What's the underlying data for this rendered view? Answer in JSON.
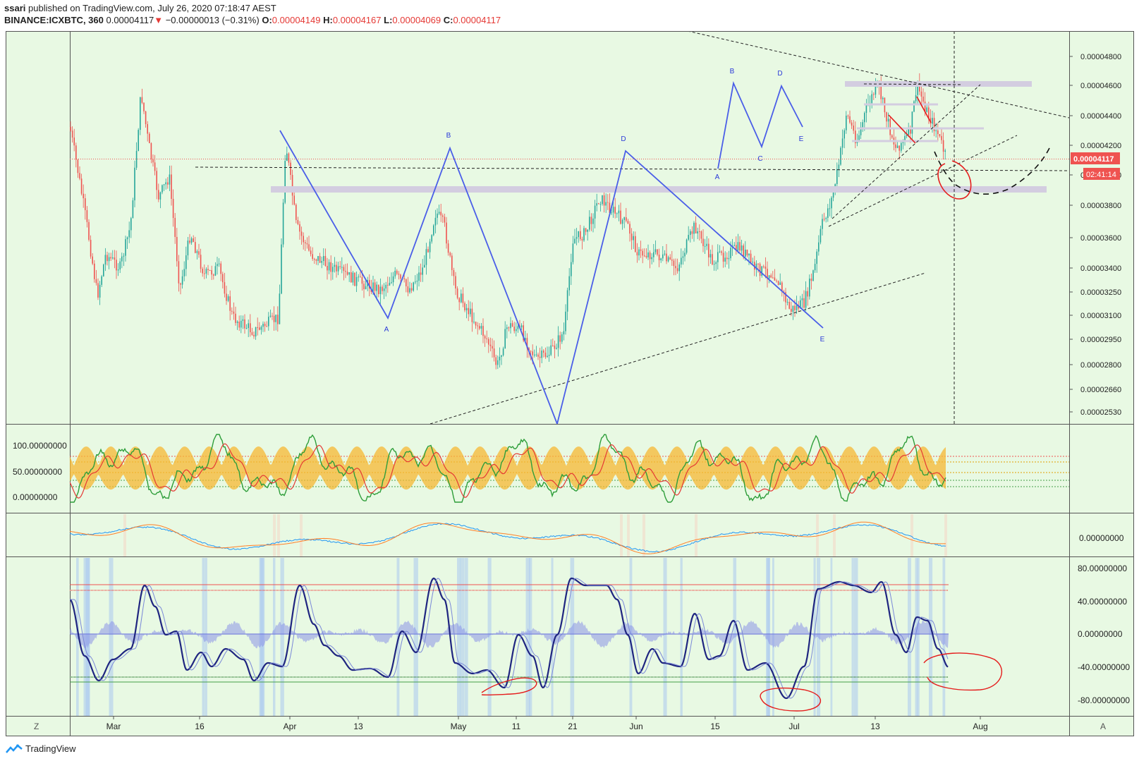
{
  "header": {
    "publisher": "ssari",
    "published_text": "published on TradingView.com, July 26, 2020 07:18:47 AEST",
    "symbol": "BINANCE:ICXBTC, 360",
    "last": "0.00004117",
    "change_arrow": "▼",
    "change": "−0.00000013 (−0.31%)",
    "o_label": "O:",
    "o": "0.00004149",
    "h_label": "H:",
    "h": "0.00004167",
    "l_label": "L:",
    "l": "0.00004069",
    "c_label": "C:",
    "c": "0.00004117"
  },
  "price_axis": [
    "0.00004800",
    "0.00004600",
    "0.00004400",
    "0.00004200",
    "0.00004000",
    "0.00003800",
    "0.00003600",
    "0.00003400",
    "0.00003250",
    "0.00003100",
    "0.00002950",
    "0.00002800",
    "0.00002660",
    "0.00002530"
  ],
  "price_badge": "0.00004117",
  "countdown_badge": "02:41:14",
  "osc1_axis": [
    "100.00000000",
    "50.00000000",
    "0.00000000"
  ],
  "macd_axis": [
    "0.00000000"
  ],
  "osc3_axis": [
    "80.00000000",
    "40.00000000",
    "0.00000000",
    "-40.00000000",
    "-80.00000000"
  ],
  "time_axis": [
    "Mar",
    "16",
    "Apr",
    "13",
    "May",
    "11",
    "21",
    "Jun",
    "15",
    "Jul",
    "13",
    "Aug"
  ],
  "corner_left": "Z",
  "corner_right": "A",
  "footer_brand": "TradingView",
  "pattern_labels_main": [
    "A",
    "B",
    "D",
    "E"
  ],
  "pattern_labels_small": [
    "A",
    "B",
    "C",
    "D",
    "E"
  ],
  "colors": {
    "bg": "#e8f9e3",
    "up": "#26a69a",
    "down": "#ef5350",
    "pattern": "#4a5ee8",
    "zone": "#d3cde0",
    "red_mark": "#e51c1c",
    "osc_blue": "#2a2fa0"
  },
  "chart_data": [
    {
      "type": "line",
      "title": "",
      "x": [
        "Mar",
        "16",
        "Apr",
        "13",
        "May",
        "11",
        "21",
        "Jun",
        "15",
        "Jul",
        "13",
        "Aug"
      ],
      "ylim": [
        2.53e-05,
        4.85e-05
      ],
      "series": [
        {
          "values": [
            3.95e-05,
            3.3e-05,
            4.05e-05,
            3.25e-05,
            3.45e-05,
            2.9e-05,
            3.55e-05,
            3.65e-05,
            3.4e-05,
            3.25e-05,
            4.4e-05,
            4.12e-05
          ]
        }
      ],
      "last_value": 4.117e-05
    },
    {
      "type": "line",
      "title": "",
      "ylim": [
        -10,
        110
      ],
      "levels": [
        100,
        50,
        0
      ]
    },
    {
      "type": "line",
      "title": "",
      "levels": [
        0
      ]
    },
    {
      "type": "line",
      "title": "",
      "ylim": [
        -90,
        90
      ],
      "levels": [
        80,
        40,
        0,
        -40,
        -80
      ]
    }
  ]
}
